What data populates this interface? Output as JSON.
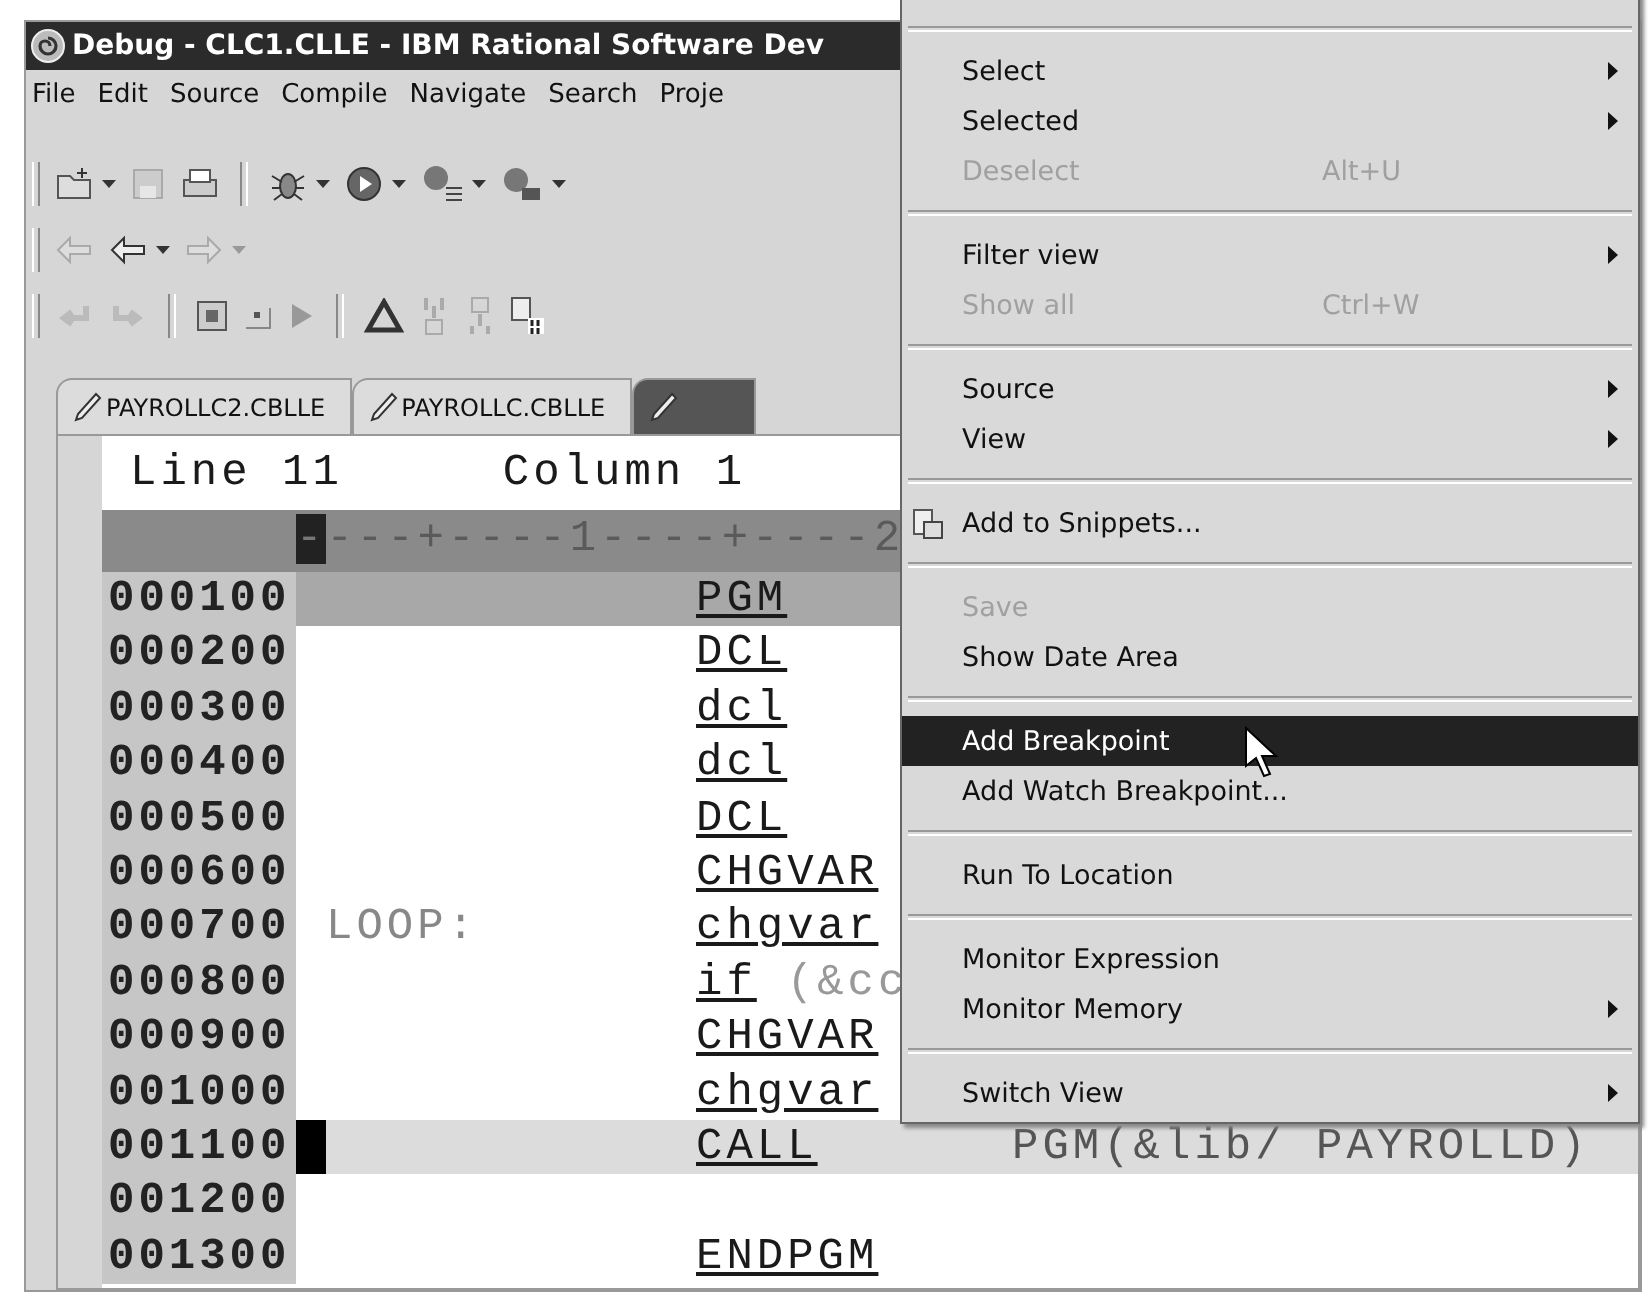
{
  "window": {
    "title": "Debug - CLC1.CLLE - IBM Rational Software Dev"
  },
  "menu_bar": [
    "File",
    "Edit",
    "Source",
    "Compile",
    "Navigate",
    "Search",
    "Proje"
  ],
  "tabs": [
    {
      "label": "PAYROLLC2.CBLLE",
      "selected": false
    },
    {
      "label": "PAYROLLC.CBLLE",
      "selected": false
    },
    {
      "selected": true
    }
  ],
  "editor": {
    "line_label": "Line 11",
    "column_label": "Column 1",
    "ruler": "----+----1----+----2",
    "rows": [
      {
        "number": "000100",
        "command": "PGM",
        "kind": "statement",
        "shaded": true,
        "current": false
      },
      {
        "number": "000200",
        "command": "DCL",
        "kind": "statement",
        "shaded": false,
        "current": false
      },
      {
        "number": "000300",
        "command": "dcl",
        "kind": "statement",
        "shaded": false,
        "current": false
      },
      {
        "number": "000400",
        "command": "dcl",
        "kind": "statement",
        "shaded": false,
        "current": false
      },
      {
        "number": "000500",
        "command": "DCL",
        "kind": "statement",
        "shaded": false,
        "current": false
      },
      {
        "number": "000600",
        "command": "CHGVAR",
        "kind": "statement",
        "shaded": false,
        "current": false
      },
      {
        "number": "000700",
        "label": "LOOP:",
        "command": "chgvar",
        "kind": "statement",
        "shaded": false,
        "current": false
      },
      {
        "number": "000800",
        "command": "if",
        "args": "(&cc",
        "kind": "condition",
        "shaded": false,
        "current": false
      },
      {
        "number": "000900",
        "command": "CHGVAR",
        "kind": "statement",
        "shaded": false,
        "current": false
      },
      {
        "number": "001000",
        "command": "chgvar",
        "kind": "statement",
        "shaded": false,
        "current": false
      },
      {
        "number": "001100",
        "command": "CALL",
        "args": "PGM(&lib/ PAYROLLD)",
        "kind": "statement",
        "shaded": false,
        "current": true
      },
      {
        "number": "001200",
        "shaded": false,
        "current": false
      },
      {
        "number": "001300",
        "command": "ENDPGM",
        "kind": "statement",
        "shaded": false,
        "current": false
      }
    ]
  },
  "context_menu": {
    "groups": [
      [
        {
          "label": "Select",
          "submenu": true,
          "disabled": false,
          "selected": false
        },
        {
          "label": "Selected",
          "submenu": true,
          "disabled": false,
          "selected": false
        },
        {
          "label": "Deselect",
          "shortcut": "Alt+U",
          "submenu": false,
          "disabled": true,
          "selected": false
        }
      ],
      [
        {
          "label": "Filter view",
          "submenu": true,
          "disabled": false,
          "selected": false
        },
        {
          "label": "Show all",
          "shortcut": "Ctrl+W",
          "submenu": false,
          "disabled": true,
          "selected": false
        }
      ],
      [
        {
          "label": "Source",
          "submenu": true,
          "disabled": false,
          "selected": false
        },
        {
          "label": "View",
          "submenu": true,
          "disabled": false,
          "selected": false
        }
      ],
      [
        {
          "label": "Add to Snippets...",
          "icon": true,
          "submenu": false,
          "disabled": false,
          "selected": false
        }
      ],
      [
        {
          "label": "Save",
          "submenu": false,
          "disabled": true,
          "selected": false
        },
        {
          "label": "Show Date Area",
          "submenu": false,
          "disabled": false,
          "selected": false
        }
      ],
      [
        {
          "label": "Add Breakpoint",
          "submenu": false,
          "disabled": false,
          "selected": true
        },
        {
          "label": "Add Watch Breakpoint...",
          "submenu": false,
          "disabled": false,
          "selected": false
        }
      ],
      [
        {
          "label": "Run To Location",
          "submenu": false,
          "disabled": false,
          "selected": false
        }
      ],
      [
        {
          "label": "Monitor Expression",
          "submenu": false,
          "disabled": false,
          "selected": false
        },
        {
          "label": "Monitor Memory",
          "submenu": true,
          "disabled": false,
          "selected": false
        }
      ],
      [
        {
          "label": "Switch View",
          "submenu": true,
          "disabled": false,
          "selected": false
        }
      ]
    ]
  }
}
